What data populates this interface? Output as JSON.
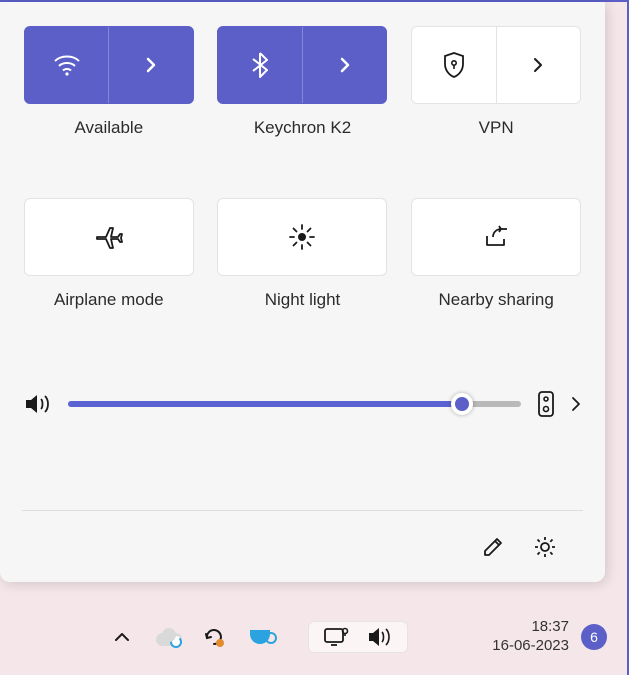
{
  "quick_settings": {
    "tiles": [
      {
        "id": "wifi",
        "label": "Available",
        "active": true,
        "split": true
      },
      {
        "id": "bluetooth",
        "label": "Keychron K2",
        "active": true,
        "split": true
      },
      {
        "id": "vpn",
        "label": "VPN",
        "active": false,
        "split": true
      },
      {
        "id": "airplane",
        "label": "Airplane mode",
        "active": false,
        "split": false
      },
      {
        "id": "nightlight",
        "label": "Night light",
        "active": false,
        "split": false
      },
      {
        "id": "nearby",
        "label": "Nearby sharing",
        "active": false,
        "split": false
      }
    ],
    "volume": {
      "percent": 87
    }
  },
  "taskbar": {
    "time": "18:37",
    "date": "16-06-2023",
    "notifications_badge": "6"
  }
}
